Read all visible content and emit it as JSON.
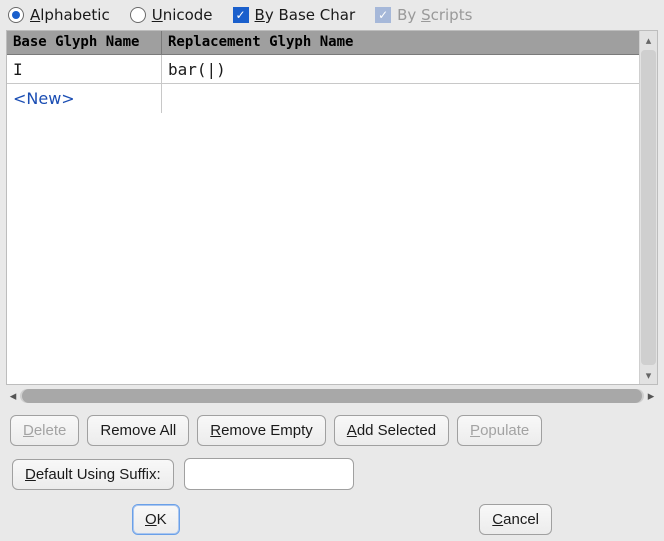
{
  "options": {
    "alphabetic": "Alphabetic",
    "unicode": "Unicode",
    "by_base_char": "By Base Char",
    "by_scripts": "By Scripts"
  },
  "table": {
    "headers": {
      "base": "Base Glyph Name",
      "replacement": "Replacement Glyph Name"
    },
    "rows": [
      {
        "base": "I",
        "replacement": "bar(|)"
      }
    ],
    "new_label": "<New>"
  },
  "actions": {
    "delete": "Delete",
    "remove_all": "Remove All",
    "remove_empty": "Remove Empty",
    "add_selected": "Add Selected",
    "populate": "Populate"
  },
  "suffix": {
    "button": "Default Using Suffix:",
    "value": ""
  },
  "dialog": {
    "ok": "OK",
    "cancel": "Cancel"
  }
}
